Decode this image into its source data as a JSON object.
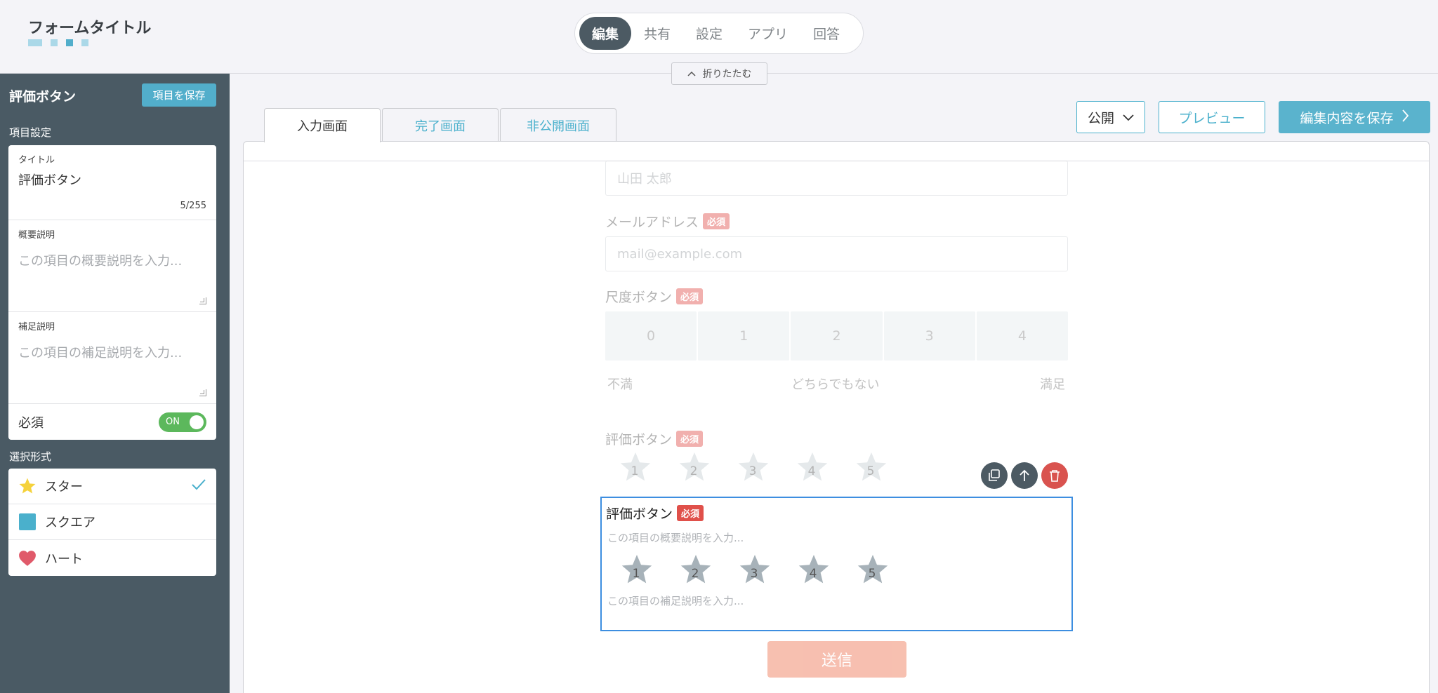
{
  "header": {
    "form_title": "フォームタイトル",
    "tabs": [
      {
        "label": "編集",
        "active": true
      },
      {
        "label": "共有",
        "active": false
      },
      {
        "label": "設定",
        "active": false
      },
      {
        "label": "アプリ",
        "active": false
      },
      {
        "label": "回答",
        "active": false
      }
    ],
    "collapse_label": "折りたたむ"
  },
  "sidebar": {
    "title": "評価ボタン",
    "save_label": "項目を保存",
    "item_settings_heading": "項目設定",
    "title_field": {
      "label": "タイトル",
      "value": "評価ボタン",
      "count": "5/255"
    },
    "summary_field": {
      "label": "概要説明",
      "placeholder": "この項目の概要説明を入力..."
    },
    "note_field": {
      "label": "補足説明",
      "placeholder": "この項目の補足説明を入力..."
    },
    "required": {
      "label": "必須",
      "state": "ON"
    },
    "selection_heading": "選択形式",
    "options": [
      {
        "label": "スター",
        "icon": "star-icon",
        "selected": true
      },
      {
        "label": "スクエア",
        "icon": "square-icon",
        "selected": false
      },
      {
        "label": "ハート",
        "icon": "heart-icon",
        "selected": false
      }
    ]
  },
  "main": {
    "tabs": [
      {
        "label": "入力画面",
        "active": true
      },
      {
        "label": "完了画面",
        "active": false
      },
      {
        "label": "非公開画面",
        "active": false
      }
    ],
    "public_label": "公開",
    "preview_label": "プレビュー",
    "save_edit_label": "編集内容を保存"
  },
  "form": {
    "name_placeholder": "山田 太郎",
    "email": {
      "label": "メールアドレス",
      "badge": "必須",
      "placeholder": "mail@example.com"
    },
    "scale": {
      "label": "尺度ボタン",
      "badge": "必須",
      "values": [
        "0",
        "1",
        "2",
        "3",
        "4"
      ],
      "left": "不満",
      "center": "どちらでもない",
      "right": "満足"
    },
    "rating_preview": {
      "label": "評価ボタン",
      "badge": "必須",
      "stars": [
        "1",
        "2",
        "3",
        "4",
        "5"
      ]
    },
    "rating_selected": {
      "label": "評価ボタン",
      "badge": "必須",
      "summary_placeholder": "この項目の概要説明を入力...",
      "note_placeholder": "この項目の補足説明を入力...",
      "stars": [
        "1",
        "2",
        "3",
        "4",
        "5"
      ]
    },
    "submit_label": "送信"
  },
  "colors": {
    "accent": "#4ab0cc",
    "sidebar_bg": "#4a5a64",
    "required_badge": "#e0504a",
    "toggle_on": "#5cb85c",
    "selection_border": "#3d8ee0"
  }
}
